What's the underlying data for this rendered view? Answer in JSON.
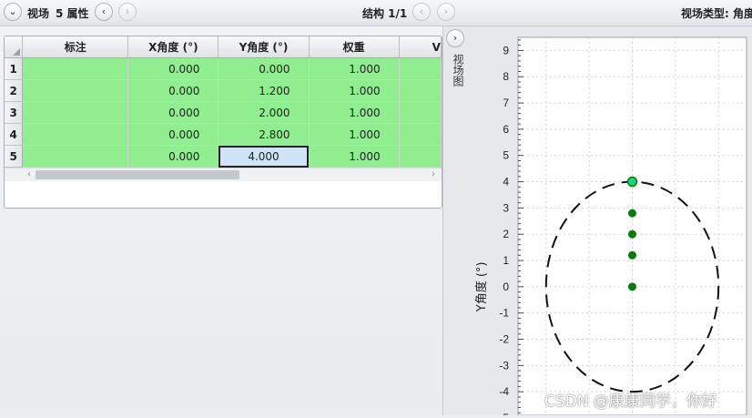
{
  "toolbar": {
    "collapse_icon": "chevron-down-icon",
    "title": "视场",
    "prop_label": "5 属性",
    "prev_icon": "chevron-left-icon",
    "next_icon": "chevron-right-icon",
    "structure_label": "结构 1/1",
    "field_type_label": "视场类型: 角度"
  },
  "grid": {
    "columns": [
      "标注",
      "X角度 (°)",
      "Y角度 (°)",
      "权重",
      "V"
    ],
    "rows": [
      {
        "num": "1",
        "label": "",
        "x": "0.000",
        "y": "0.000",
        "w": "1.000"
      },
      {
        "num": "2",
        "label": "",
        "x": "0.000",
        "y": "1.200",
        "w": "1.000"
      },
      {
        "num": "3",
        "label": "",
        "x": "0.000",
        "y": "2.000",
        "w": "1.000"
      },
      {
        "num": "4",
        "label": "",
        "x": "0.000",
        "y": "2.800",
        "w": "1.000"
      },
      {
        "num": "5",
        "label": "",
        "x": "0.000",
        "y": "4.000",
        "w": "1.000"
      }
    ],
    "selected_row": 5,
    "selected_col": "y",
    "row_color": "#90ee90"
  },
  "side_tab": {
    "label": "视场图",
    "expand_icon": "chevron-right-icon"
  },
  "chart_data": {
    "type": "scatter",
    "ylabel": "Y角度 (°)",
    "ylim": [
      -5,
      9.5
    ],
    "xlim": [
      -5.3,
      5.3
    ],
    "yticks": [
      9,
      8,
      7,
      6,
      5,
      4,
      3,
      2,
      1,
      0,
      -1,
      -2,
      -3,
      -4,
      -5
    ],
    "grid": true,
    "points": [
      {
        "x": 0,
        "y": 0
      },
      {
        "x": 0,
        "y": 1.2
      },
      {
        "x": 0,
        "y": 2.0
      },
      {
        "x": 0,
        "y": 2.8
      },
      {
        "x": 0,
        "y": 4.0,
        "selected": true
      }
    ],
    "circle_radius": 4.0,
    "point_color": "#0a7a0a",
    "selected_point_color": "#1fd08a"
  },
  "watermark": "CSDN @康康同学，你好"
}
